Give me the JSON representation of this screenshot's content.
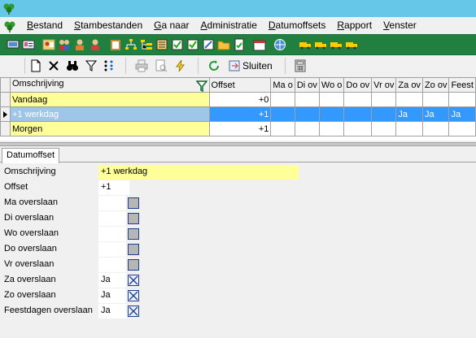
{
  "menu": {
    "items": [
      {
        "label": "Bestand",
        "ul": "B",
        "rest": "estand"
      },
      {
        "label": "Stambestanden",
        "ul": "S",
        "rest": "tambestanden"
      },
      {
        "label": "Ga naar",
        "ul": "G",
        "rest": "a naar"
      },
      {
        "label": "Administratie",
        "ul": "A",
        "rest": "dministratie"
      },
      {
        "label": "Datumoffsets",
        "ul": "D",
        "rest": "atumoffsets"
      },
      {
        "label": "Rapport",
        "ul": "R",
        "rest": "apport"
      },
      {
        "label": "Venster",
        "ul": "V",
        "rest": "enster"
      }
    ]
  },
  "subtoolbar": {
    "sluiten_label": "Sluiten"
  },
  "grid": {
    "columns": [
      "Omschrijving",
      "Offset",
      "Ma o",
      "Di ov",
      "Wo o",
      "Do ov",
      "Vr ov",
      "Za ov",
      "Zo ov",
      "Feest"
    ],
    "rows": [
      {
        "omschrijving": "Vandaag",
        "offset": "+0",
        "ma": "",
        "di": "",
        "wo": "",
        "do": "",
        "vr": "",
        "za": "",
        "zo": "",
        "feest": ""
      },
      {
        "omschrijving": "+1 werkdag",
        "offset": "+1",
        "ma": "",
        "di": "",
        "wo": "",
        "do": "",
        "vr": "",
        "za": "Ja",
        "zo": "Ja",
        "feest": "Ja"
      },
      {
        "omschrijving": "Morgen",
        "offset": "+1",
        "ma": "",
        "di": "",
        "wo": "",
        "do": "",
        "vr": "",
        "za": "",
        "zo": "",
        "feest": ""
      }
    ]
  },
  "detail": {
    "tab_label": "Datumoffset",
    "fields": {
      "omschrijving": {
        "label": "Omschrijving",
        "value": "+1 werkdag"
      },
      "offset": {
        "label": "Offset",
        "value": "+1"
      },
      "ma": {
        "label": "Ma overslaan",
        "value": "",
        "checked": false
      },
      "di": {
        "label": "Di overslaan",
        "value": "",
        "checked": false
      },
      "wo": {
        "label": "Wo overslaan",
        "value": "",
        "checked": false
      },
      "do": {
        "label": "Do overslaan",
        "value": "",
        "checked": false
      },
      "vr": {
        "label": "Vr overslaan",
        "value": "",
        "checked": false
      },
      "za": {
        "label": "Za overslaan",
        "value": "Ja",
        "checked": true
      },
      "zo": {
        "label": "Zo overslaan",
        "value": "Ja",
        "checked": true
      },
      "feest": {
        "label": "Feestdagen overslaan",
        "value": "Ja",
        "checked": true
      }
    }
  },
  "colors": {
    "titlebar": "#66c7e8",
    "toolbar_green": "#217f3f",
    "selection": "#3399ff",
    "yellow_field": "#ffff99"
  }
}
